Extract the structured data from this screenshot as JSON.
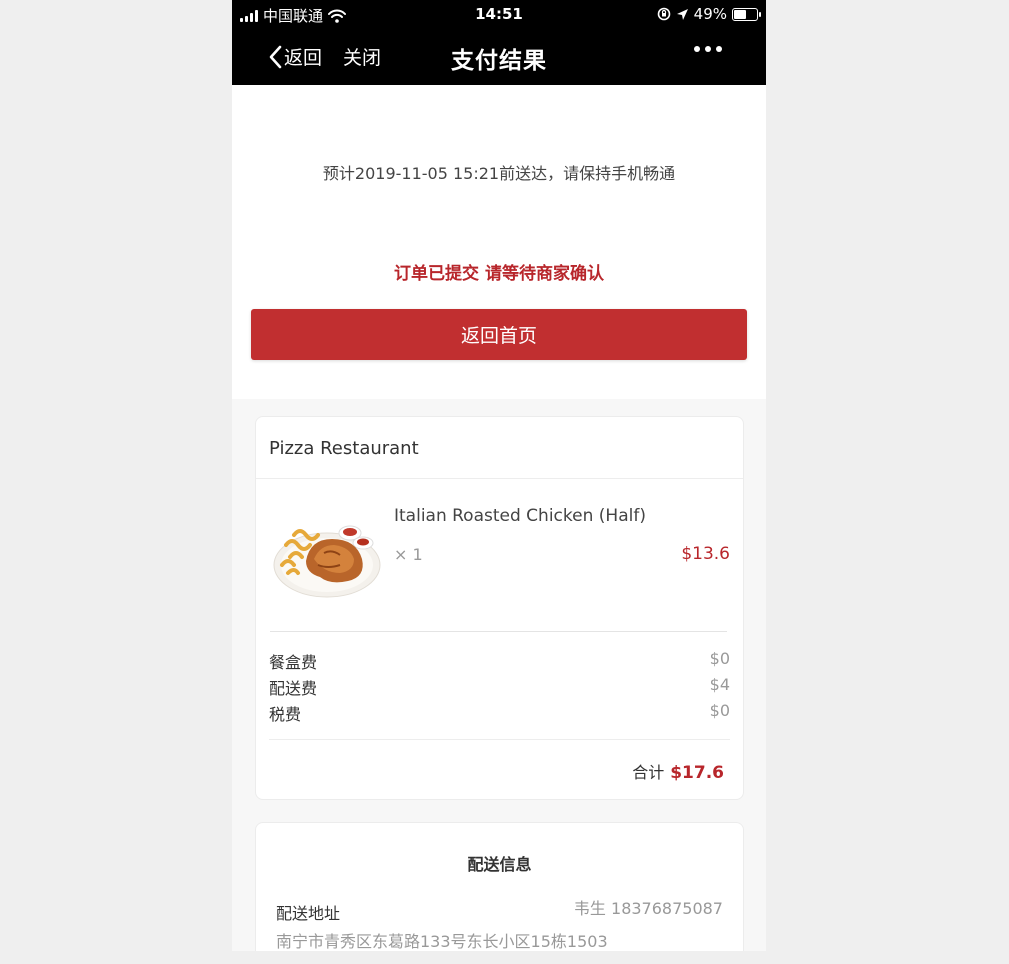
{
  "status_bar": {
    "carrier": "中国联通",
    "time": "14:51",
    "battery": "49%",
    "battery_level": 0.49
  },
  "navbar": {
    "back_label": "返回",
    "close_label": "关闭",
    "title": "支付结果"
  },
  "result": {
    "eta_text": "预计2019-11-05 15:21前送达，请保持手机畅通",
    "status_text": "订单已提交 请等待商家确认",
    "home_button": "返回首页"
  },
  "order": {
    "store_name": "Pizza Restaurant",
    "item": {
      "name": "Italian Roasted Chicken (Half)",
      "qty": "× 1",
      "price": "$13.6"
    },
    "fees": [
      {
        "label": "餐盒费",
        "value": "$0"
      },
      {
        "label": "配送费",
        "value": "$4"
      },
      {
        "label": "税费",
        "value": "$0"
      }
    ],
    "total_label": "合计",
    "total_value": "$17.6"
  },
  "delivery": {
    "title": "配送信息",
    "address_label": "配送地址",
    "contact": "韦生 18376875087",
    "address": "南宁市青秀区东葛路133号东长小区15栋1503"
  },
  "colors": {
    "accent": "#c12f30",
    "price": "#b8262b"
  }
}
